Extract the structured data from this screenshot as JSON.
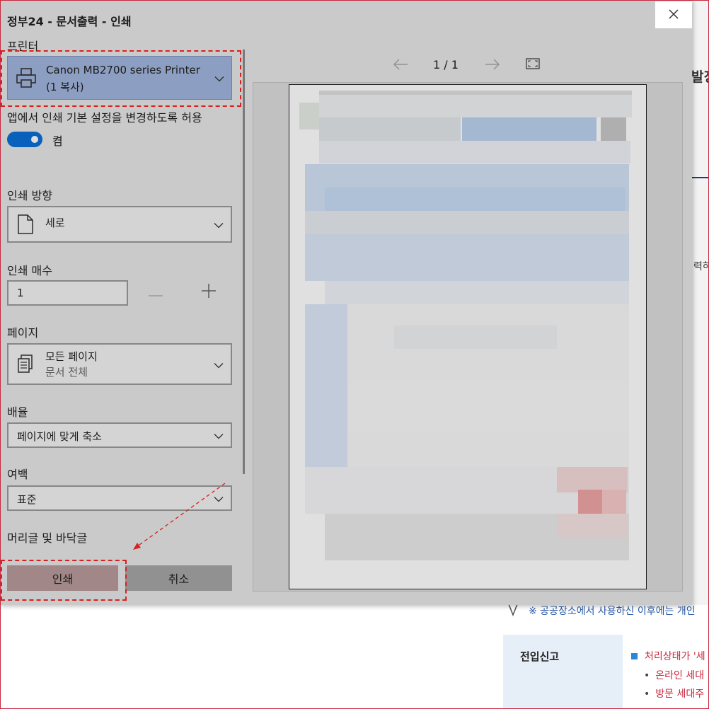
{
  "window_title": "정부24 - 문서출력 - 인쇄",
  "printer": {
    "label": "프린터",
    "name": "Canon MB2700 series Printer",
    "copy_note": "(1 복사)"
  },
  "app_setting": {
    "label": "앱에서 인쇄 기본 설정을 변경하도록 허용",
    "toggle_state": "켬"
  },
  "orientation": {
    "label": "인쇄 방향",
    "value": "세로"
  },
  "copies": {
    "label": "인쇄 매수",
    "value": "1",
    "minus": "—",
    "plus": "+"
  },
  "pages": {
    "label": "페이지",
    "value": "모든 페이지",
    "sub": "문서 전체"
  },
  "scale": {
    "label": "배율",
    "value": "페이지에 맞게 축소"
  },
  "margins": {
    "label": "여백",
    "value": "표준"
  },
  "header_footer": {
    "label": "머리글 및 바닥글"
  },
  "buttons": {
    "print": "인쇄",
    "cancel": "취소"
  },
  "preview": {
    "page_indicator": "1 / 1"
  },
  "background": {
    "heading_fragment": "발징",
    "side_fragment": "력하",
    "note": "※ 공공장소에서 사용하신 이후에는 개인",
    "row_title": "전입신고",
    "row_line1": "처리상태가 '세",
    "row_line2": "온라인 세대",
    "row_line3": "방문 세대주"
  },
  "colors": {
    "accent_toggle": "#0b6fd6",
    "printer_selected": "#a0b4dc",
    "highlight_annotation": "#d82020",
    "note_text": "#2a5aa8",
    "warning_text": "#c8283e"
  }
}
